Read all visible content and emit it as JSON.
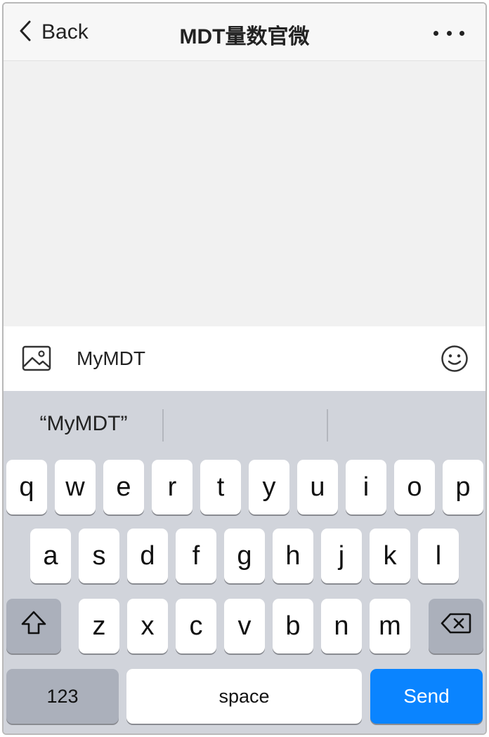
{
  "navbar": {
    "back_label": "Back",
    "title": "MDT量数官微",
    "more_icon": "more-dots-icon"
  },
  "input_bar": {
    "image_icon": "image-icon",
    "message_value": "MyMDT",
    "emoji_icon": "emoji-icon"
  },
  "keyboard": {
    "suggestions": [
      "“MyMDT”",
      "",
      ""
    ],
    "row1": [
      "q",
      "w",
      "e",
      "r",
      "t",
      "y",
      "u",
      "i",
      "o",
      "p"
    ],
    "row2": [
      "a",
      "s",
      "d",
      "f",
      "g",
      "h",
      "j",
      "k",
      "l"
    ],
    "row3": [
      "z",
      "x",
      "c",
      "v",
      "b",
      "n",
      "m"
    ],
    "shift_icon": "shift-icon",
    "delete_icon": "backspace-icon",
    "numbers_label": "123",
    "space_label": "space",
    "send_label": "Send",
    "send_color": "#0a84ff"
  }
}
